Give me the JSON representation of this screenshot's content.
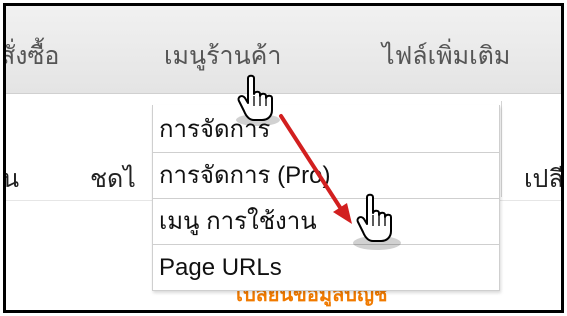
{
  "menubar": {
    "items": [
      "สั่งซื้อ",
      "เมนูร้านค้า",
      "ไฟล์เพิ่มเติม"
    ]
  },
  "subbar": {
    "items": [
      "น",
      "ชดไ",
      "เปลี"
    ]
  },
  "dropdown": {
    "items": [
      "การจัดการ",
      "การจัดการ (Pro)",
      "เมนู การใช้งาน",
      "Page URLs"
    ]
  },
  "content": {
    "orange_text": "เปลี่ยนข้อมูลบัญชี"
  },
  "colors": {
    "arrow": "#d21f1f",
    "link": "#f07a00"
  },
  "icons": {
    "cursor_top": "hand-pointer-icon",
    "cursor_bottom": "hand-pointer-icon"
  }
}
